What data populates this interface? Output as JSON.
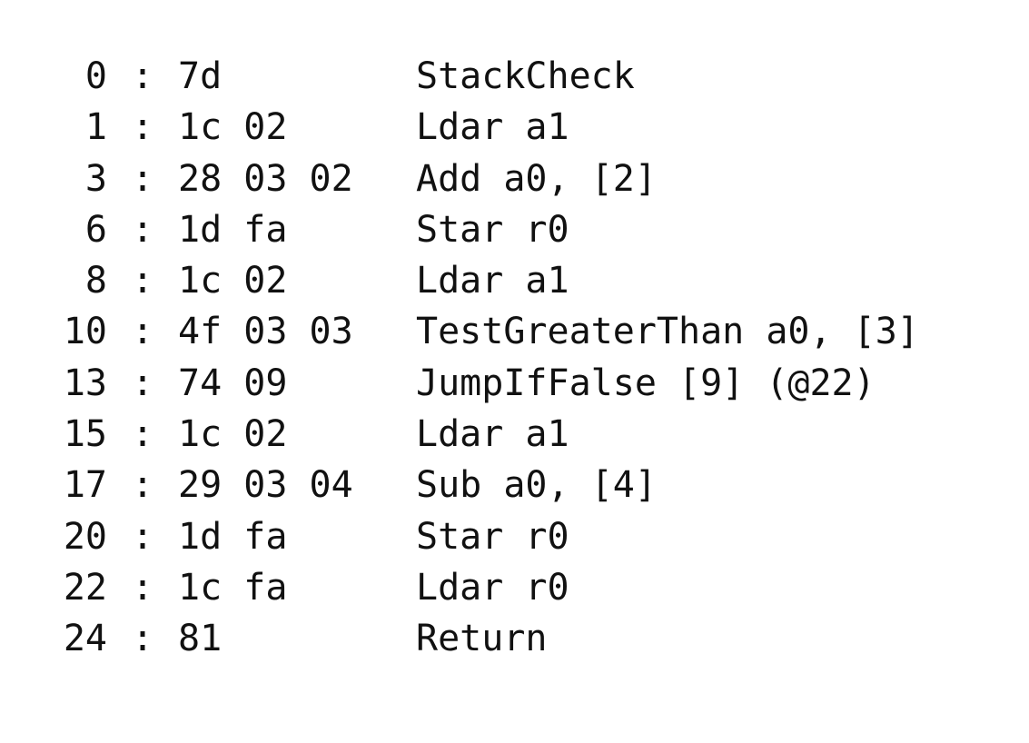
{
  "separator": ":",
  "rows": [
    {
      "offset": "0",
      "bytes": "7d",
      "instruction": "StackCheck"
    },
    {
      "offset": "1",
      "bytes": "1c 02",
      "instruction": "Ldar a1"
    },
    {
      "offset": "3",
      "bytes": "28 03 02",
      "instruction": "Add a0, [2]"
    },
    {
      "offset": "6",
      "bytes": "1d fa",
      "instruction": "Star r0"
    },
    {
      "offset": "8",
      "bytes": "1c 02",
      "instruction": "Ldar a1"
    },
    {
      "offset": "10",
      "bytes": "4f 03 03",
      "instruction": "TestGreaterThan a0, [3]"
    },
    {
      "offset": "13",
      "bytes": "74 09",
      "instruction": "JumpIfFalse [9] (@22)"
    },
    {
      "offset": "15",
      "bytes": "1c 02",
      "instruction": "Ldar a1"
    },
    {
      "offset": "17",
      "bytes": "29 03 04",
      "instruction": "Sub a0, [4]"
    },
    {
      "offset": "20",
      "bytes": "1d fa",
      "instruction": "Star r0"
    },
    {
      "offset": "22",
      "bytes": "1c fa",
      "instruction": "Ldar r0"
    },
    {
      "offset": "24",
      "bytes": "81",
      "instruction": "Return"
    }
  ]
}
